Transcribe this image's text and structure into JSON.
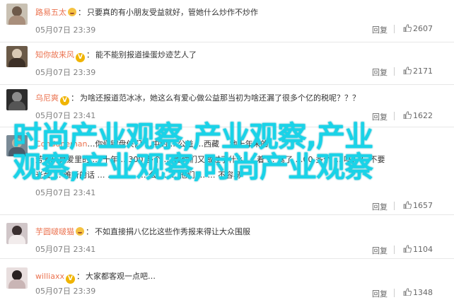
{
  "comments": [
    {
      "username": "路易五太",
      "text": "只要真的有小朋友受益就好，管她什么炒作不炒作",
      "time": "05月07日 23:39",
      "reply_label": "回复",
      "likes": "2607",
      "has_emoji": true,
      "has_vip": false,
      "avatar_color": "#c9c1b3"
    },
    {
      "username": "知你故来风",
      "text": "能不能别报道操蛋炒迹艺人了",
      "time": "05月07日 23:39",
      "reply_label": "回复",
      "likes": "2171",
      "has_emoji": false,
      "has_vip": true,
      "avatar_color": "#6b5a48"
    },
    {
      "username": "乌尼爽",
      "text": "为啥还报道范冰冰，她这么有爱心做公益那当初为啥还漏了很多个亿的税呢？？？",
      "time": "05月07日 23:41",
      "reply_label": "回复",
      "likes": "1622",
      "has_emoji": false,
      "has_vip": true,
      "avatar_color": "#2c2c2c"
    },
    {
      "username": "Conduneman",
      "text_line1": "…你们键盘侠们 …中的 …公益 …西藏 …地十年来的",
      "text_line2": "芳芳玩具爱里的 … 十年 …300 多个 … 面你们又做过了什么 … 着 … 驾了 …00 多个 … 吗？？ 不要",
      "text_line3": "光会 … 难听的话 … … … … … 么 … … 他们 … … 不容易",
      "time": "05月07日 23:41",
      "reply_label": "回复",
      "likes": "1657",
      "avatar_color": "#7a8a96"
    },
    {
      "username": "芋圆啵啵猫",
      "text": "不如直接捐八亿比这些作秀报来得让大众围服",
      "time": "05月07日 23:41",
      "reply_label": "回复",
      "likes": "1104",
      "has_emoji": true,
      "has_vip": false,
      "avatar_color": "#d0c6c8"
    },
    {
      "username": "williaxx",
      "text": "大家都客观一点吧…",
      "time": "05月07日 23:39",
      "reply_label": "回复",
      "likes": "1348",
      "has_emoji": false,
      "has_vip": true,
      "avatar_color": "#e8dede"
    }
  ],
  "overlay": {
    "line1": "时尚产业观察,产业观察,产业",
    "line2": "观察,产业观察,时尚产业观察"
  },
  "colors": {
    "username": "#eb7350",
    "overlay": "#19d3e8",
    "meta": "#808080"
  }
}
